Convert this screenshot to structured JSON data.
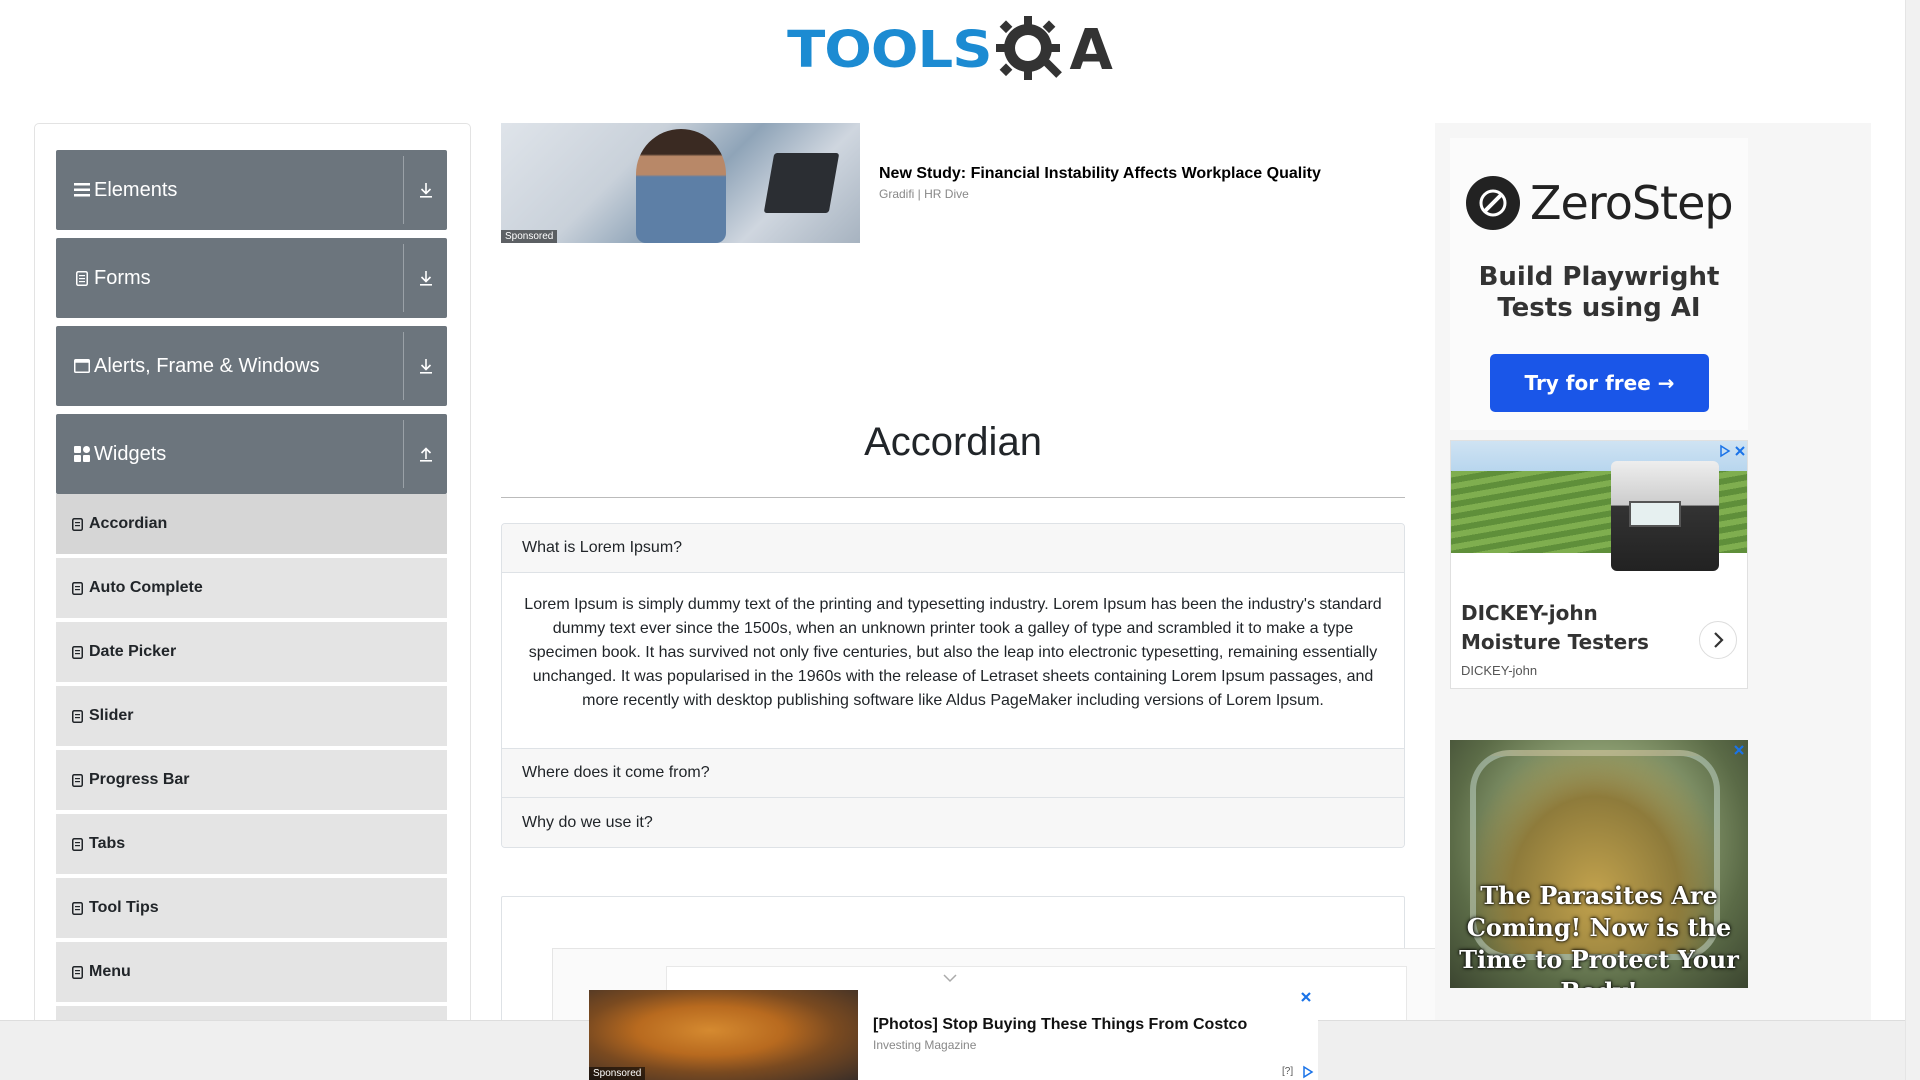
{
  "header": {
    "logo_text": "TOOLS",
    "logo_q": "Q",
    "logo_a": "A"
  },
  "sidebar": {
    "groups": [
      {
        "label": "Elements",
        "icon": "hamburger-icon",
        "toggle_icon": "download-icon"
      },
      {
        "label": "Forms",
        "icon": "document-icon",
        "toggle_icon": "download-icon"
      },
      {
        "label": "Alerts, Frame & Windows",
        "icon": "window-icon",
        "toggle_icon": "download-icon"
      },
      {
        "label": "Widgets",
        "icon": "widgets-icon",
        "toggle_icon": "upload-icon"
      }
    ],
    "items": [
      {
        "label": "Accordian",
        "active": true
      },
      {
        "label": "Auto Complete"
      },
      {
        "label": "Date Picker"
      },
      {
        "label": "Slider"
      },
      {
        "label": "Progress Bar"
      },
      {
        "label": "Tabs"
      },
      {
        "label": "Tool Tips"
      },
      {
        "label": "Menu"
      }
    ]
  },
  "top_ad": {
    "title": "New Study: Financial Instability Affects Workplace Quality",
    "source": "Gradifi | HR Dive",
    "badge": "Sponsored"
  },
  "main": {
    "title": "Accordian",
    "sections": [
      {
        "heading": "What is Lorem Ipsum?",
        "body": "Lorem Ipsum is simply dummy text of the printing and typesetting industry. Lorem Ipsum has been the industry's standard dummy text ever since the 1500s, when an unknown printer took a galley of type and scrambled it to make a type specimen book. It has survived not only five centuries, but also the leap into electronic typesetting, remaining essentially unchanged. It was popularised in the 1960s with the release of Letraset sheets containing Lorem Ipsum passages, and more recently with desktop publishing software like Aldus PageMaker including versions of Lorem Ipsum."
      },
      {
        "heading": "Where does it come from?"
      },
      {
        "heading": "Why do we use it?"
      }
    ]
  },
  "right_ads": {
    "zerostep": {
      "name": "ZeroStep",
      "tagline": "Build Playwright Tests using AI",
      "button": "Try for free →"
    },
    "dickey": {
      "title": "DICKEY-john Moisture Testers",
      "source": "DICKEY-john"
    },
    "parasite": {
      "text": "The Parasites Are Coming! Now is the Time to Protect Your Body!"
    }
  },
  "bottom_ad": {
    "title": "[Photos] Stop Buying These Things From Costco",
    "source": "Investing Magazine",
    "badge": "Sponsored",
    "help": "[?]"
  },
  "colors": {
    "brand_blue": "#1c8bd2",
    "sidebar_header": "#6c757d",
    "menu_item": "#e4e4e4",
    "cta_blue": "#1a56e8"
  }
}
